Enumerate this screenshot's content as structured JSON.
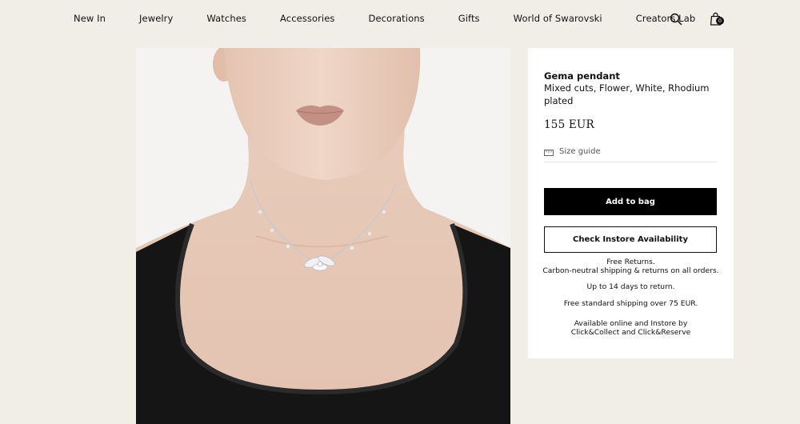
{
  "nav": {
    "items": [
      {
        "label": "New In"
      },
      {
        "label": "Jewelry"
      },
      {
        "label": "Watches"
      },
      {
        "label": "Accessories"
      },
      {
        "label": "Decorations"
      },
      {
        "label": "Gifts"
      },
      {
        "label": "World of Swarovski"
      },
      {
        "label": "Creators Lab"
      }
    ],
    "search_icon": "search-icon",
    "bag_icon": "shopping-bag-icon",
    "bag_count": "0"
  },
  "product": {
    "name": "Gema pendant",
    "description": "Mixed cuts, Flower, White, Rhodium plated",
    "price": "155 EUR",
    "size_guide_label": "Size guide",
    "size_guide_icon": "ruler-icon",
    "add_to_bag_label": "Add to bag",
    "check_store_label": "Check Instore Availability"
  },
  "info": {
    "returns_title": "Free Returns.",
    "returns_detail": "Carbon-neutral shipping & returns on all orders.",
    "return_window": "Up to 14 days to return.",
    "shipping": "Free standard shipping over 75 EUR.",
    "availability_line1": "Available online and Instore by",
    "availability_line2": "Click&Collect and Click&Reserve"
  },
  "colors": {
    "page_bg": "#f1eee8",
    "primary_button": "#000000",
    "panel_bg": "#ffffff"
  }
}
